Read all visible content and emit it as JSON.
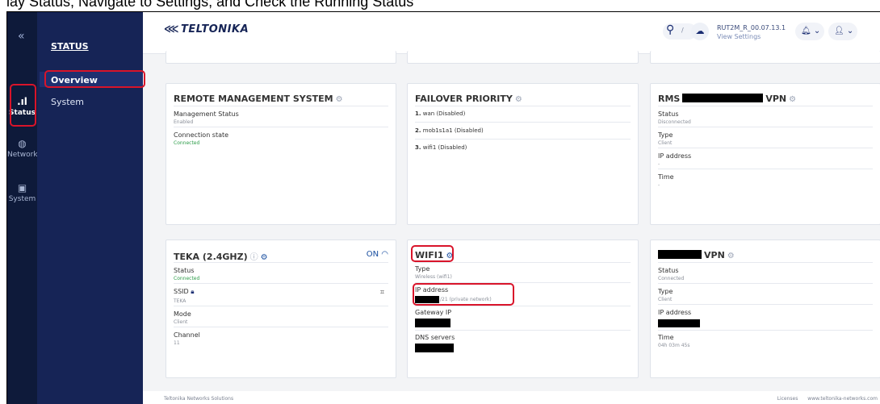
{
  "caption": "lay Status, Navigate to Settings, and Check the Running Status",
  "rail": {
    "collapse_icon": "«",
    "items": [
      {
        "label": "Status",
        "icon": "signal-icon",
        "active": true
      },
      {
        "label": "Network",
        "icon": "globe-icon"
      },
      {
        "label": "System",
        "icon": "device-icon"
      }
    ]
  },
  "subnav": {
    "title": "STATUS",
    "items": [
      {
        "label": "Overview",
        "active": true
      },
      {
        "label": "System"
      }
    ]
  },
  "header": {
    "brand": "TELTONIKA",
    "search_key": "/",
    "device_name": "RUT2M_R_00.07.13.1",
    "view_settings": "View Settings"
  },
  "cards": {
    "rms": {
      "title": "REMOTE MANAGEMENT SYSTEM",
      "fields": [
        {
          "label": "Management Status",
          "value": "Enabled",
          "status": "neutral"
        },
        {
          "label": "Connection state",
          "value": "Connected",
          "status": "good"
        }
      ]
    },
    "failover": {
      "title": "FAILOVER PRIORITY",
      "items": [
        {
          "n": "1.",
          "text": "wan (Disabled)"
        },
        {
          "n": "2.",
          "text": "mob1s1a1 (Disabled)"
        },
        {
          "n": "3.",
          "text": "wifi1 (Disabled)"
        }
      ]
    },
    "rms_vpn": {
      "title_left": "RMS",
      "title_right": "VPN",
      "fields": [
        {
          "label": "Status",
          "value": "Disconnected"
        },
        {
          "label": "Type",
          "value": "Client"
        },
        {
          "label": "IP address",
          "value": "-"
        },
        {
          "label": "Time",
          "value": "-"
        }
      ]
    },
    "teka": {
      "title": "TEKA (2.4GHZ)",
      "state": "ON",
      "fields": [
        {
          "label": "Status",
          "value": "Connected",
          "status": "good"
        },
        {
          "label": "SSID",
          "value": "TEKA"
        },
        {
          "label": "Mode",
          "value": "Client"
        },
        {
          "label": "Channel",
          "value": "11"
        }
      ]
    },
    "wifi1": {
      "title": "WIFI1",
      "fields": [
        {
          "label": "Type",
          "value": "Wireless (wifi1)"
        },
        {
          "label": "IP address",
          "value": "/21 (private network)"
        },
        {
          "label": "Gateway IP",
          "value": ""
        },
        {
          "label": "DNS servers",
          "value": ""
        }
      ]
    },
    "vpn": {
      "title": "VPN",
      "fields": [
        {
          "label": "Status",
          "value": "Connected"
        },
        {
          "label": "Type",
          "value": "Client"
        },
        {
          "label": "IP address",
          "value": ""
        },
        {
          "label": "Time",
          "value": "04h 03m 45s"
        }
      ]
    }
  },
  "footer": {
    "left": "Teltonika Networks Solutions",
    "licenses": "Licenses",
    "website": "www.teltonika-networks.com"
  },
  "colors": {
    "rail": "#0e1a3a",
    "subnav": "#162456",
    "accent": "#1a4fa0",
    "highlight": "#d9142a",
    "status_good": "#2e9d4a"
  }
}
